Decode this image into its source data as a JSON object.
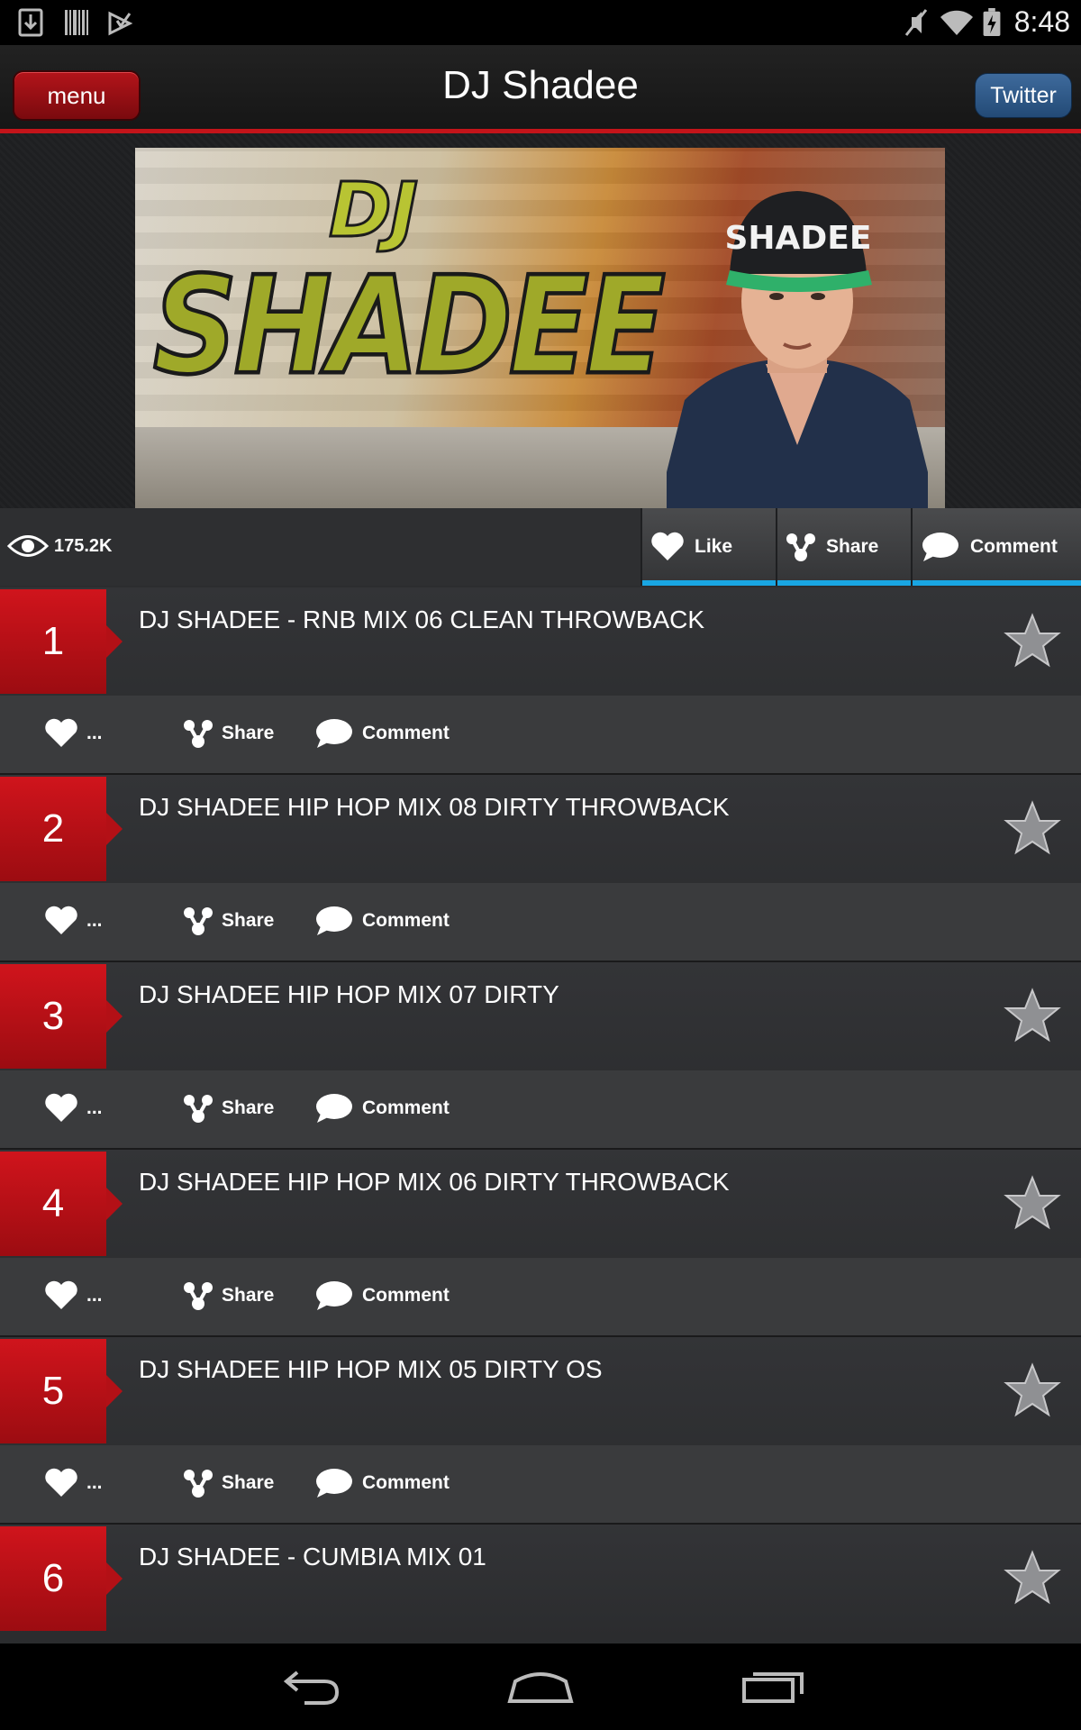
{
  "status_bar": {
    "time": "8:48",
    "left_icons": [
      "download-icon",
      "barcode-icon",
      "play-store-icon"
    ],
    "right_icons": [
      "mute-icon",
      "wifi-icon",
      "battery-icon"
    ]
  },
  "header": {
    "menu_label": "menu",
    "title": "DJ Shadee",
    "twitter_label": "Twitter",
    "accent_color": "#c3141a"
  },
  "banner": {
    "logo_top": "DJ",
    "logo_main": "SHADEE",
    "cap_text": "SHADEE"
  },
  "stats": {
    "views": "175.2K",
    "like_label": "Like",
    "share_label": "Share",
    "comment_label": "Comment",
    "underline_color": "#19a6e3"
  },
  "tracks": [
    {
      "rank": "1",
      "title": "DJ SHADEE - RNB MIX 06 CLEAN THROWBACK",
      "likes": "...",
      "share": "Share",
      "comment": "Comment"
    },
    {
      "rank": "2",
      "title": "DJ SHADEE HIP HOP MIX 08 DIRTY THROWBACK",
      "likes": "...",
      "share": "Share",
      "comment": "Comment"
    },
    {
      "rank": "3",
      "title": "DJ SHADEE HIP HOP MIX 07 DIRTY",
      "likes": "...",
      "share": "Share",
      "comment": "Comment"
    },
    {
      "rank": "4",
      "title": "DJ SHADEE HIP HOP MIX 06 DIRTY THROWBACK",
      "likes": "...",
      "share": "Share",
      "comment": "Comment"
    },
    {
      "rank": "5",
      "title": "DJ SHADEE HIP HOP MIX 05 DIRTY OS",
      "likes": "...",
      "share": "Share",
      "comment": "Comment"
    },
    {
      "rank": "6",
      "title": "DJ SHADEE - CUMBIA MIX 01"
    }
  ],
  "nav": [
    "back-icon",
    "home-icon",
    "recents-icon"
  ]
}
